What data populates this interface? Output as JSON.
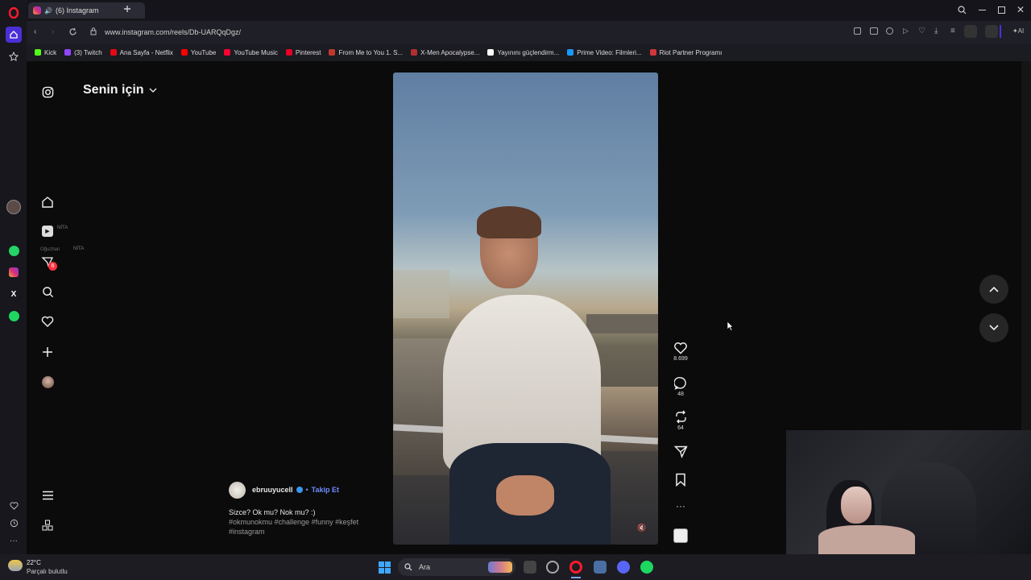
{
  "browser": {
    "tab_title": "(6) Instagram",
    "url": "www.instagram.com/reels/Db-UARQqDgz/",
    "bookmarks": [
      {
        "label": "Kick",
        "color": "#53fc18"
      },
      {
        "label": "(3) Twitch",
        "color": "#9146ff"
      },
      {
        "label": "Ana Sayfa - Netflix",
        "color": "#e50914"
      },
      {
        "label": "YouTube",
        "color": "#ff0000"
      },
      {
        "label": "YouTube Music",
        "color": "#ff0033"
      },
      {
        "label": "Pinterest",
        "color": "#e60023"
      },
      {
        "label": "From Me to You 1. S...",
        "color": "#c0392b"
      },
      {
        "label": "X-Men Apocalypse...",
        "color": "#b03030"
      },
      {
        "label": "Yayınını güçlendirm...",
        "color": "#ffffff"
      },
      {
        "label": "Prime Video: Filmleri...",
        "color": "#1a98ff"
      },
      {
        "label": "Riot Partner Programı",
        "color": "#d13639"
      }
    ]
  },
  "instagram": {
    "feed_title": "Senin için",
    "notification_count": "6",
    "author": "ebruuyucell",
    "follow_label": "Takip Et",
    "caption": "Sizce? Ok mu? Nok mu? :)",
    "hashtags_line1": "#okmunokmu #challenge #funny #keşfet",
    "hashtags_line2": "#instagram",
    "likes": "8.699",
    "comments": "48",
    "reposts": "64",
    "sidebar_hint_1": "NİTA",
    "sidebar_hint_2": "NİTA",
    "sidebar_hint_user": "Oğuzhan"
  },
  "taskbar": {
    "weather_temp": "22°C",
    "weather_desc": "Parçalı bulutlu",
    "search_placeholder": "Ara"
  },
  "colors": {
    "accent_opera": "#4b2fd6",
    "follow_blue": "#6f8bff",
    "notification_red": "#ff3040"
  }
}
